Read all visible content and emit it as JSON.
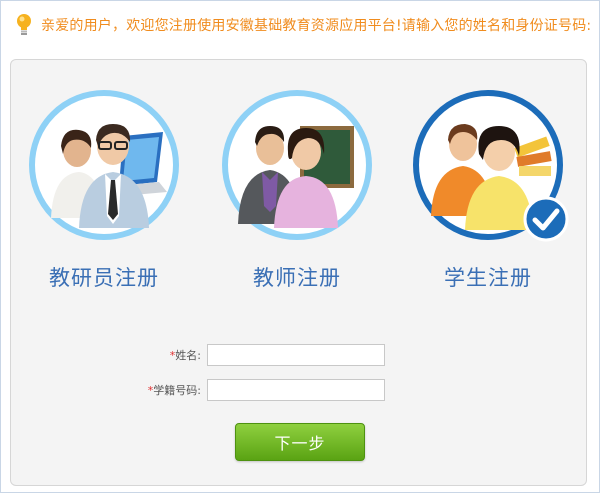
{
  "notice": {
    "icon": "lightbulb-icon",
    "text": "亲爱的用户，欢迎您注册使用安徽基础教育资源应用平台!请输入您的姓名和身份证号码:"
  },
  "roles": [
    {
      "label": "教研员注册",
      "icon": "researchers-group-icon",
      "selected": false
    },
    {
      "label": "教师注册",
      "icon": "teachers-group-icon",
      "selected": false
    },
    {
      "label": "学生注册",
      "icon": "students-group-icon",
      "selected": true
    }
  ],
  "form": {
    "name": {
      "required_mark": "*",
      "label": "姓名:",
      "value": "",
      "placeholder": ""
    },
    "student_id": {
      "required_mark": "*",
      "label": "学籍号码:",
      "value": "",
      "placeholder": ""
    }
  },
  "next_button": {
    "label": "下一步"
  },
  "colors": {
    "notice_text": "#f08c1e",
    "role_label": "#3a6fb5",
    "ring_normal": "#8ed1f6",
    "ring_selected": "#1c6cb9",
    "button_green": "#6cb822",
    "required": "#e03030"
  }
}
